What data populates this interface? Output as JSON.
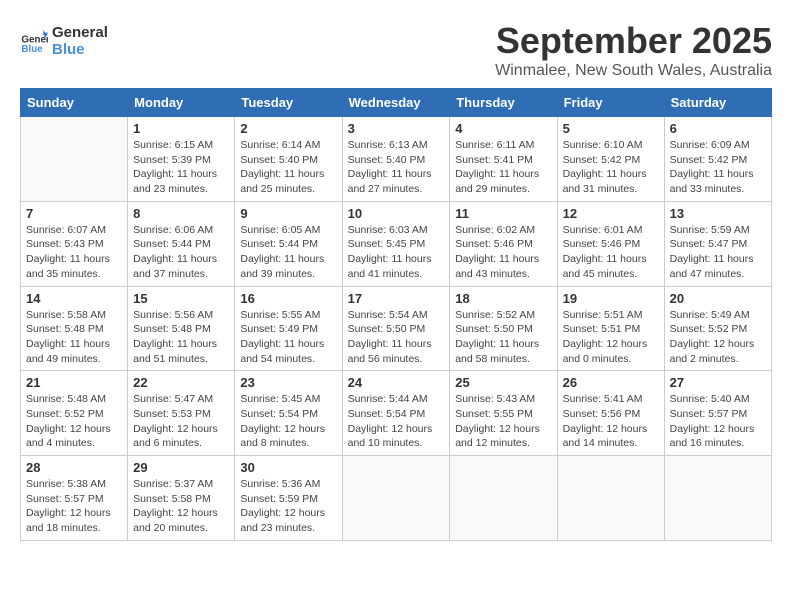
{
  "logo": {
    "line1": "General",
    "line2": "Blue"
  },
  "title": "September 2025",
  "location": "Winmalee, New South Wales, Australia",
  "days_of_week": [
    "Sunday",
    "Monday",
    "Tuesday",
    "Wednesday",
    "Thursday",
    "Friday",
    "Saturday"
  ],
  "weeks": [
    [
      {
        "day": "",
        "info": ""
      },
      {
        "day": "1",
        "info": "Sunrise: 6:15 AM\nSunset: 5:39 PM\nDaylight: 11 hours\nand 23 minutes."
      },
      {
        "day": "2",
        "info": "Sunrise: 6:14 AM\nSunset: 5:40 PM\nDaylight: 11 hours\nand 25 minutes."
      },
      {
        "day": "3",
        "info": "Sunrise: 6:13 AM\nSunset: 5:40 PM\nDaylight: 11 hours\nand 27 minutes."
      },
      {
        "day": "4",
        "info": "Sunrise: 6:11 AM\nSunset: 5:41 PM\nDaylight: 11 hours\nand 29 minutes."
      },
      {
        "day": "5",
        "info": "Sunrise: 6:10 AM\nSunset: 5:42 PM\nDaylight: 11 hours\nand 31 minutes."
      },
      {
        "day": "6",
        "info": "Sunrise: 6:09 AM\nSunset: 5:42 PM\nDaylight: 11 hours\nand 33 minutes."
      }
    ],
    [
      {
        "day": "7",
        "info": "Sunrise: 6:07 AM\nSunset: 5:43 PM\nDaylight: 11 hours\nand 35 minutes."
      },
      {
        "day": "8",
        "info": "Sunrise: 6:06 AM\nSunset: 5:44 PM\nDaylight: 11 hours\nand 37 minutes."
      },
      {
        "day": "9",
        "info": "Sunrise: 6:05 AM\nSunset: 5:44 PM\nDaylight: 11 hours\nand 39 minutes."
      },
      {
        "day": "10",
        "info": "Sunrise: 6:03 AM\nSunset: 5:45 PM\nDaylight: 11 hours\nand 41 minutes."
      },
      {
        "day": "11",
        "info": "Sunrise: 6:02 AM\nSunset: 5:46 PM\nDaylight: 11 hours\nand 43 minutes."
      },
      {
        "day": "12",
        "info": "Sunrise: 6:01 AM\nSunset: 5:46 PM\nDaylight: 11 hours\nand 45 minutes."
      },
      {
        "day": "13",
        "info": "Sunrise: 5:59 AM\nSunset: 5:47 PM\nDaylight: 11 hours\nand 47 minutes."
      }
    ],
    [
      {
        "day": "14",
        "info": "Sunrise: 5:58 AM\nSunset: 5:48 PM\nDaylight: 11 hours\nand 49 minutes."
      },
      {
        "day": "15",
        "info": "Sunrise: 5:56 AM\nSunset: 5:48 PM\nDaylight: 11 hours\nand 51 minutes."
      },
      {
        "day": "16",
        "info": "Sunrise: 5:55 AM\nSunset: 5:49 PM\nDaylight: 11 hours\nand 54 minutes."
      },
      {
        "day": "17",
        "info": "Sunrise: 5:54 AM\nSunset: 5:50 PM\nDaylight: 11 hours\nand 56 minutes."
      },
      {
        "day": "18",
        "info": "Sunrise: 5:52 AM\nSunset: 5:50 PM\nDaylight: 11 hours\nand 58 minutes."
      },
      {
        "day": "19",
        "info": "Sunrise: 5:51 AM\nSunset: 5:51 PM\nDaylight: 12 hours\nand 0 minutes."
      },
      {
        "day": "20",
        "info": "Sunrise: 5:49 AM\nSunset: 5:52 PM\nDaylight: 12 hours\nand 2 minutes."
      }
    ],
    [
      {
        "day": "21",
        "info": "Sunrise: 5:48 AM\nSunset: 5:52 PM\nDaylight: 12 hours\nand 4 minutes."
      },
      {
        "day": "22",
        "info": "Sunrise: 5:47 AM\nSunset: 5:53 PM\nDaylight: 12 hours\nand 6 minutes."
      },
      {
        "day": "23",
        "info": "Sunrise: 5:45 AM\nSunset: 5:54 PM\nDaylight: 12 hours\nand 8 minutes."
      },
      {
        "day": "24",
        "info": "Sunrise: 5:44 AM\nSunset: 5:54 PM\nDaylight: 12 hours\nand 10 minutes."
      },
      {
        "day": "25",
        "info": "Sunrise: 5:43 AM\nSunset: 5:55 PM\nDaylight: 12 hours\nand 12 minutes."
      },
      {
        "day": "26",
        "info": "Sunrise: 5:41 AM\nSunset: 5:56 PM\nDaylight: 12 hours\nand 14 minutes."
      },
      {
        "day": "27",
        "info": "Sunrise: 5:40 AM\nSunset: 5:57 PM\nDaylight: 12 hours\nand 16 minutes."
      }
    ],
    [
      {
        "day": "28",
        "info": "Sunrise: 5:38 AM\nSunset: 5:57 PM\nDaylight: 12 hours\nand 18 minutes."
      },
      {
        "day": "29",
        "info": "Sunrise: 5:37 AM\nSunset: 5:58 PM\nDaylight: 12 hours\nand 20 minutes."
      },
      {
        "day": "30",
        "info": "Sunrise: 5:36 AM\nSunset: 5:59 PM\nDaylight: 12 hours\nand 23 minutes."
      },
      {
        "day": "",
        "info": ""
      },
      {
        "day": "",
        "info": ""
      },
      {
        "day": "",
        "info": ""
      },
      {
        "day": "",
        "info": ""
      }
    ]
  ]
}
